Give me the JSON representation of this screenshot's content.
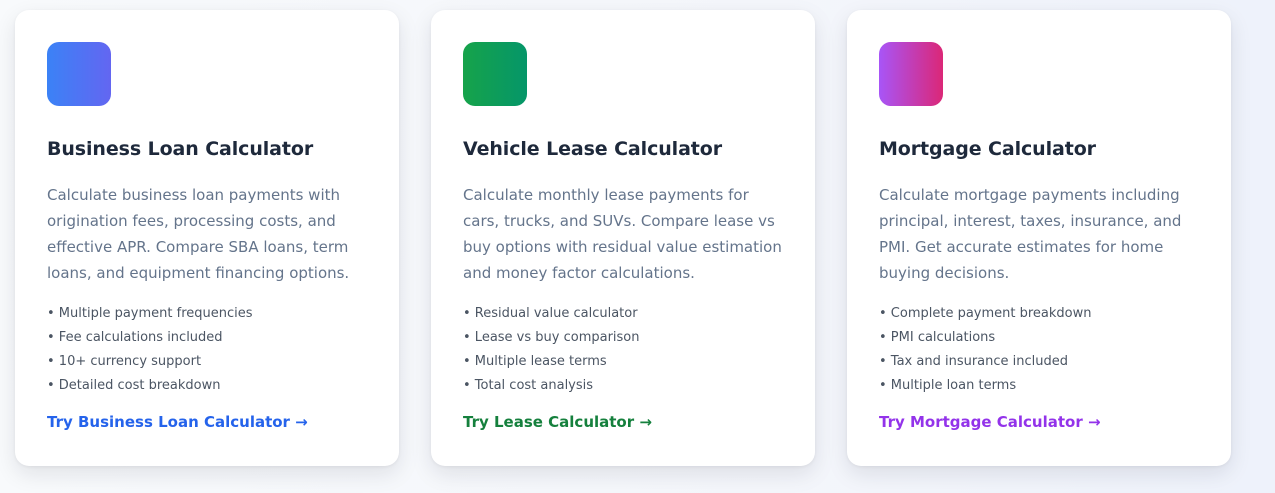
{
  "cards": [
    {
      "title": "Business Loan Calculator",
      "description": "Calculate business loan payments with origination fees, processing costs, and effective APR. Compare SBA loans, term loans, and equipment financing options.",
      "features": [
        "• Multiple payment frequencies",
        "• Fee calculations included",
        "• 10+ currency support",
        "• Detailed cost breakdown"
      ],
      "link": "Try Business Loan Calculator →",
      "gradient": [
        "#3b82f6",
        "#6366f1"
      ],
      "link_color": "#2563eb"
    },
    {
      "title": "Vehicle Lease Calculator",
      "description": "Calculate monthly lease payments for cars, trucks, and SUVs. Compare lease vs buy options with residual value estimation and money factor calculations.",
      "features": [
        "• Residual value calculator",
        "• Lease vs buy comparison",
        "• Multiple lease terms",
        "• Total cost analysis"
      ],
      "link": "Try Lease Calculator →",
      "gradient": [
        "#16a34a",
        "#059669"
      ],
      "link_color": "#15803d"
    },
    {
      "title": "Mortgage Calculator",
      "description": "Calculate mortgage payments including principal, interest, taxes, insurance, and PMI. Get accurate estimates for home buying decisions.",
      "features": [
        "• Complete payment breakdown",
        "• PMI calculations",
        "• Tax and insurance included",
        "• Multiple loan terms"
      ],
      "link": "Try Mortgage Calculator →",
      "gradient": [
        "#a855f7",
        "#db2777"
      ],
      "link_color": "#9333ea"
    }
  ]
}
